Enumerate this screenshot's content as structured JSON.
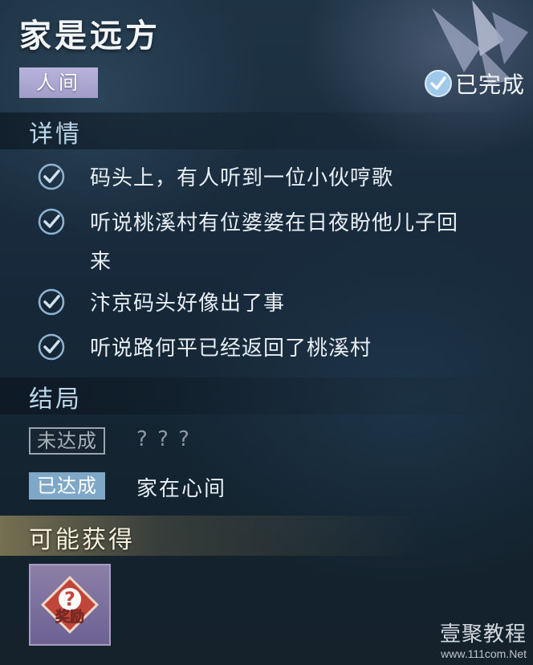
{
  "quest": {
    "title": "家是远方",
    "category_tag": "人间",
    "status_label": "已完成"
  },
  "details": {
    "heading": "详情",
    "items": [
      {
        "text": "码头上，有人听到一位小伙哼歌"
      },
      {
        "text": "听说桃溪村有位婆婆在日夜盼他儿子回"
      },
      {
        "text": "来"
      },
      {
        "text": "汴京码头好像出了事"
      },
      {
        "text": "听说路何平已经返回了桃溪村"
      }
    ]
  },
  "endings": {
    "heading": "结局",
    "items": [
      {
        "status": "未达成",
        "text": "? ? ?"
      },
      {
        "status": "已达成",
        "text": "家在心间"
      }
    ]
  },
  "rewards": {
    "heading": "可能获得",
    "item_label": "奖励",
    "item_icon": "question-mark-icon"
  },
  "watermark": {
    "name": "壹聚教程",
    "url": "www.111com.Net"
  },
  "colors": {
    "tag_world": "#a19dc9",
    "completed_badge": "#9fc9ea",
    "ending_met": "#7fa7c8",
    "reward_slot": "#7a6f9c",
    "reward_diamond": "#c0463a"
  }
}
